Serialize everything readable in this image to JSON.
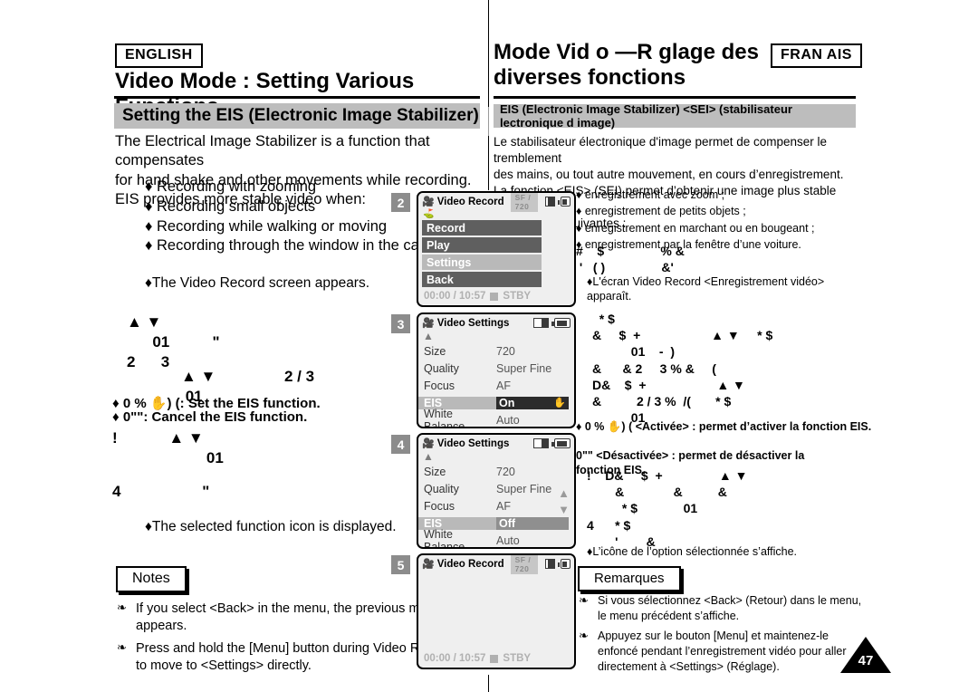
{
  "page": {
    "number": "47",
    "languages": {
      "english": "ENGLISH",
      "french": "FRAN AIS"
    }
  },
  "english": {
    "chapter_title": "Video Mode : Setting Various Functions",
    "section_banner": "Setting the EIS (Electronic Image Stabilizer)",
    "intro": "The Electrical Image Stabilizer is a function that compensates\nfor hand shake and other movements while recording.\nEIS provides more stable video when:",
    "bullets": [
      "Recording with zooming",
      "Recording small objects",
      "Recording while walking or moving",
      "Recording through the window in the car"
    ],
    "result_1": "The Video Record screen appears.",
    "result_2": "The selected function icon is displayed.",
    "garbled_1": "▲ ▼\n      01          \"\n2      3",
    "garbled_2": "▲ ▼                2 / 3\n 01",
    "garbled_3": "!            ▲ ▼\n                      01",
    "garbled_4": "4                   \"",
    "option_on": "0 % ✋) (: Set the EIS function.",
    "option_off": "0\"\": Cancel the EIS function.",
    "notes_title": "Notes",
    "notes": [
      "If you select <Back> in the menu, the previous menu appears.",
      "Press and hold the [Menu] button during Video Recording to move to <Settings> directly."
    ]
  },
  "french": {
    "chapter_title": "Mode Vid o —R glage des\ndiverses fonctions",
    "section_banner": "EIS (Electronic Image Stabilizer) <SEI> (stabilisateur  lectronique d image)",
    "intro": "Le stabilisateur électronique d'image permet de compenser le tremblement\ndes mains, ou tout autre mouvement, en cours d’enregistrement.\nLa fonction <EIS> (SEI) permet d’obtenir une image plus stable dans\nles situations suivantes :",
    "bullets": [
      "enregistrement avec zoom ;",
      "enregistrement de petits objets ;",
      "enregistrement en marchant ou en bougeant ;",
      "enregistrement par la fenêtre d’une voiture."
    ],
    "result_1": "L'écran Video Record <Enregistrement vidéo>\n    apparaît.",
    "result_2": "L’icône de l’option sélectionnée s’affiche.",
    "garbled_1": "#    $                % &\n '   ( )                &'",
    "garbled_2": "  * $\n&     $  +                    ▲ ▼     * $\n           01    -  )\n&      & 2     3 % &     (\nD&    $  +                    ▲ ▼\n&          2 / 3 %  /(       * $\n           01",
    "garbled_3": "!    D&     $  +                ▲ ▼\n        &              &          &\n          * $             01\n4      * $\n        '        &",
    "option_on": "0 % ✋) ( <Activée> : permet d’activer la fonction EIS.",
    "option_off": "0\"\" <Désactivée> : permet de désactiver la\n    fonction EIS.",
    "notes_title": "Remarques",
    "notes": [
      "Si vous sélectionnez <Back> (Retour) dans le menu, le menu précédent s’affiche.",
      "Appuyez sur le bouton [Menu] et maintenez-le enfoncé pendant l’enregistrement vidéo pour aller directement à <Settings> (Réglage)."
    ]
  },
  "screens": [
    {
      "step": "2",
      "type": "menu",
      "title": "Video Record",
      "quality_badge": "SF  /  720",
      "rows": [
        {
          "label": "Record",
          "highlight": false
        },
        {
          "label": "Play",
          "highlight": false
        },
        {
          "label": "Settings",
          "highlight": true
        },
        {
          "label": "Back",
          "highlight": false
        }
      ],
      "timecode": "00:00 / 10:57",
      "status": "STBY"
    },
    {
      "step": "3",
      "type": "settings",
      "title": "Video Settings",
      "rows": [
        {
          "label": "Size",
          "value": "720",
          "selected": false
        },
        {
          "label": "Quality",
          "value": "Super Fine",
          "selected": false
        },
        {
          "label": "Focus",
          "value": "AF",
          "selected": false
        },
        {
          "label": "EIS",
          "value": "On",
          "selected": true,
          "icon": "hand-icon"
        },
        {
          "label": "White Balance",
          "value": "Auto",
          "selected": false
        }
      ],
      "side_arrows": false
    },
    {
      "step": "4",
      "type": "settings",
      "title": "Video Settings",
      "rows": [
        {
          "label": "Size",
          "value": "720",
          "selected": false
        },
        {
          "label": "Quality",
          "value": "Super Fine",
          "selected": false
        },
        {
          "label": "Focus",
          "value": "AF",
          "selected": false
        },
        {
          "label": "EIS",
          "value": "Off",
          "selected": true
        },
        {
          "label": "White Balance",
          "value": "Auto",
          "selected": false
        }
      ],
      "side_arrows": true
    },
    {
      "step": "5",
      "type": "record",
      "title": "Video Record",
      "quality_badge": "SF  /  720",
      "timecode": "00:00 / 10:57",
      "status": "STBY"
    }
  ]
}
